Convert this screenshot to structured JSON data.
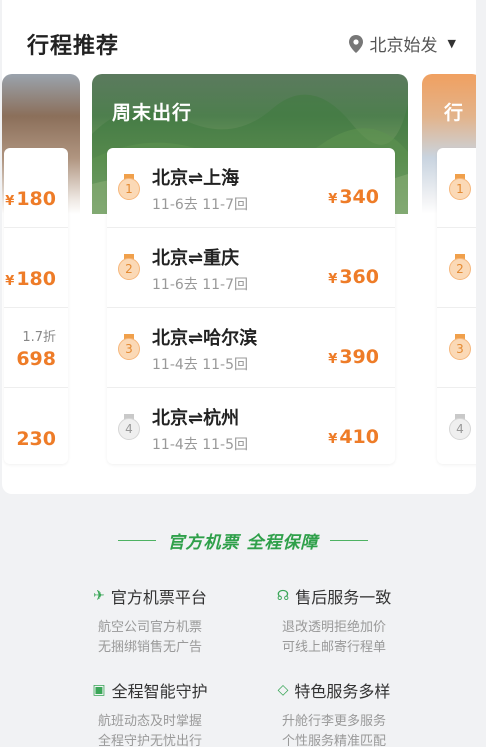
{
  "header": {
    "title": "行程推荐",
    "departure_city": "北京始发"
  },
  "main_card": {
    "title": "周末出行",
    "routes": [
      {
        "rank": "1",
        "route": "北京⇌上海",
        "dates": "11-6去 11-7回",
        "currency": "¥",
        "price": "340"
      },
      {
        "rank": "2",
        "route": "北京⇌重庆",
        "dates": "11-6去 11-7回",
        "currency": "¥",
        "price": "360"
      },
      {
        "rank": "3",
        "route": "北京⇌哈尔滨",
        "dates": "11-4去 11-5回",
        "currency": "¥",
        "price": "390"
      },
      {
        "rank": "4",
        "route": "北京⇌杭州",
        "dates": "11-4去 11-5回",
        "currency": "¥",
        "price": "410"
      }
    ]
  },
  "left_card": {
    "prices": [
      "180",
      "180",
      "698",
      "230"
    ],
    "discount": "1.7折"
  },
  "right_card": {
    "title": "行",
    "ranks": [
      "1",
      "2",
      "3",
      "4"
    ]
  },
  "guarantee": {
    "heading": "官方机票 全程保障",
    "features": [
      {
        "title": "官方机票平台",
        "line1": "航空公司官方机票",
        "line2": "无捆绑销售无广告",
        "icon": "plane-icon"
      },
      {
        "title": "售后服务一致",
        "line1": "退改透明拒绝加价",
        "line2": "可线上邮寄行程单",
        "icon": "headset-icon"
      },
      {
        "title": "全程智能守护",
        "line1": "航班动态及时掌握",
        "line2": "全程守护无忧出行",
        "icon": "chart-icon"
      },
      {
        "title": "特色服务多样",
        "line1": "升舱行李更多服务",
        "line2": "个性服务精准匹配",
        "icon": "diamond-icon"
      }
    ]
  },
  "colors": {
    "accent": "#ee7c28",
    "green": "#2fa04a"
  }
}
